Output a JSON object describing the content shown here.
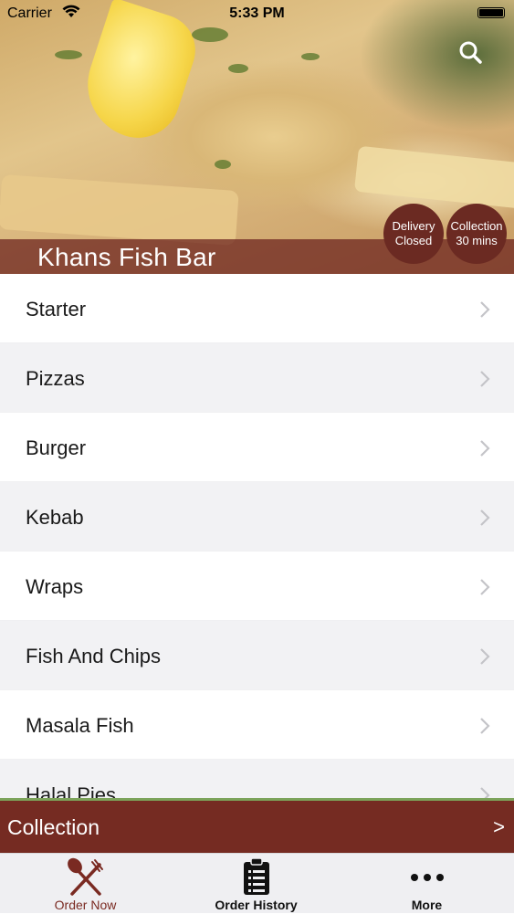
{
  "status_bar": {
    "carrier": "Carrier",
    "time": "5:33 PM"
  },
  "header": {
    "restaurant_name": "Khans Fish Bar",
    "delivery_badge": {
      "line1": "Delivery",
      "line2": "Closed"
    },
    "collection_badge": {
      "line1": "Collection",
      "line2": "30 mins"
    },
    "search_icon": "search-icon"
  },
  "menu": {
    "items": [
      {
        "label": "Starter"
      },
      {
        "label": "Pizzas"
      },
      {
        "label": "Burger"
      },
      {
        "label": "Kebab"
      },
      {
        "label": "Wraps"
      },
      {
        "label": "Fish And Chips"
      },
      {
        "label": "Masala Fish"
      },
      {
        "label": "Halal Pies"
      }
    ]
  },
  "collection_bar": {
    "label": "Collection",
    "arrow": ">"
  },
  "tab_bar": {
    "tabs": [
      {
        "label": "Order Now",
        "icon": "fork-knife-icon",
        "active": true
      },
      {
        "label": "Order History",
        "icon": "clipboard-icon"
      },
      {
        "label": "More",
        "icon": "more-dots-icon"
      }
    ]
  },
  "colors": {
    "brand": "#752b22",
    "accent_line": "#7ca35a"
  }
}
